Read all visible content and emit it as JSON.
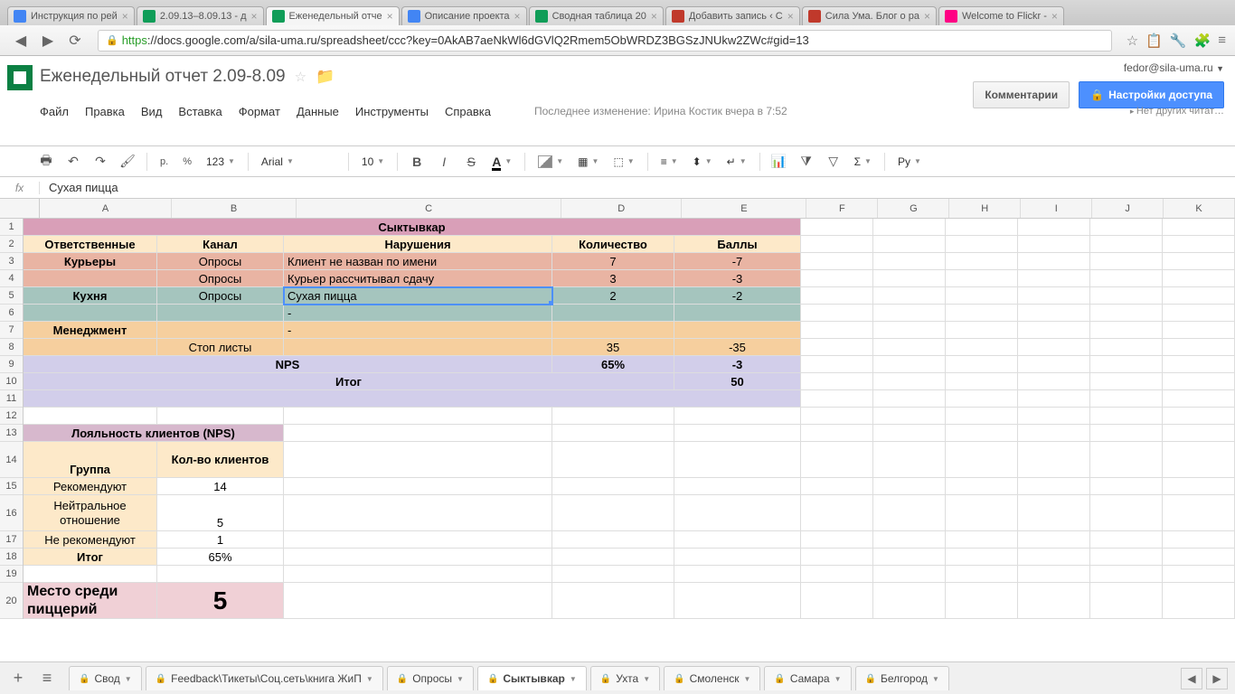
{
  "browser": {
    "tabs": [
      {
        "label": "Инструкция по рей",
        "fav": "#4285f4"
      },
      {
        "label": "2.09.13–8.09.13 - д",
        "fav": "#0f9d58"
      },
      {
        "label": "Еженедельный отче",
        "fav": "#0f9d58",
        "active": true
      },
      {
        "label": "Описание проекта",
        "fav": "#4285f4"
      },
      {
        "label": "Сводная таблица 20",
        "fav": "#0f9d58"
      },
      {
        "label": "Добавить запись ‹ С",
        "fav": "#c0392b"
      },
      {
        "label": "Сила Ума. Блог о ра",
        "fav": "#c0392b"
      },
      {
        "label": "Welcome to Flickr - ",
        "fav": "#ff0084"
      }
    ],
    "url_https": "https",
    "url_rest": "://docs.google.com/a/sila-uma.ru/spreadsheet/ccc?key=0AkAB7aeNkWl6dGVlQ2Rmem5ObWRDZ3BGSzJNUkw2ZWc#gid=13"
  },
  "doc": {
    "title": "Еженедельный отчет 2.09-8.09",
    "user": "fedor@sila-uma.ru",
    "comments_btn": "Комментарии",
    "share_btn": "Настройки доступа",
    "menus": [
      "Файл",
      "Правка",
      "Вид",
      "Вставка",
      "Формат",
      "Данные",
      "Инструменты",
      "Справка"
    ],
    "last_mod": "Последнее изменение: Ирина Костик вчера в 7:52",
    "viewers": "Нет других читат…"
  },
  "toolbar": {
    "currency": "р.",
    "percent": "%",
    "num_fmt": "123",
    "font": "Arial",
    "size": "10",
    "script": "Ру"
  },
  "fx": {
    "value": "Сухая пицца"
  },
  "cols": {
    "widths": [
      148,
      140,
      297,
      135,
      140,
      80,
      80,
      80,
      80,
      80,
      80
    ],
    "labels": [
      "A",
      "B",
      "C",
      "D",
      "E",
      "F",
      "G",
      "H",
      "I",
      "J",
      "K"
    ]
  },
  "rows": {
    "labels": [
      "1",
      "2",
      "3",
      "4",
      "5",
      "6",
      "7",
      "8",
      "9",
      "10",
      "11",
      "12",
      "13",
      "14",
      "15",
      "16",
      "17",
      "18",
      "19",
      "20"
    ],
    "tall": {
      "14": true,
      "16": true,
      "20": true
    }
  },
  "cells": {
    "r1_city": "Сыктывкар",
    "r2_a": "Ответственные",
    "r2_b": "Канал",
    "r2_c": "Нарушения",
    "r2_d": "Количество",
    "r2_e": "Баллы",
    "r3_a": "Курьеры",
    "r3_b": "Опросы",
    "r3_c": "Клиент не назван по имени",
    "r3_d": "7",
    "r3_e": "-7",
    "r4_b": "Опросы",
    "r4_c": "Курьер рассчитывал сдачу",
    "r4_d": "3",
    "r4_e": "-3",
    "r5_a": "Кухня",
    "r5_b": "Опросы",
    "r5_c": "Сухая пицца",
    "r5_d": "2",
    "r5_e": "-2",
    "r6_c": "-",
    "r7_a": "Менеджмент",
    "r7_c": "-",
    "r8_b": "Стоп листы",
    "r8_d": "35",
    "r8_e": "-35",
    "r9_nps": "NPS",
    "r9_d": "65%",
    "r9_e": "-3",
    "r10_itog": "Итог",
    "r10_e": "50",
    "r13": "Лояльность клиентов (NPS)",
    "r14_a": "Группа",
    "r14_b": "Кол-во клиентов",
    "r15_a": "Рекомендуют",
    "r15_b": "14",
    "r16_a": "Нейтральное отношение",
    "r16_b": "5",
    "r17_a": "Не рекомендуют",
    "r17_b": "1",
    "r18_a": "Итог",
    "r18_b": "65%",
    "r20_a": "Место среди пиццерий",
    "r20_b": "5"
  },
  "tabs": {
    "add": "+",
    "list": [
      {
        "label": "Свод",
        "lock": true
      },
      {
        "label": "Feedback\\Тикеты\\Соц.сеть\\книга ЖиП",
        "lock": true
      },
      {
        "label": "Опросы",
        "lock": true
      },
      {
        "label": "Сыктывкар",
        "lock": true,
        "active": true
      },
      {
        "label": "Ухта",
        "lock": true
      },
      {
        "label": "Смоленск",
        "lock": true
      },
      {
        "label": "Самара",
        "lock": true
      },
      {
        "label": "Белгород",
        "lock": true
      }
    ]
  }
}
